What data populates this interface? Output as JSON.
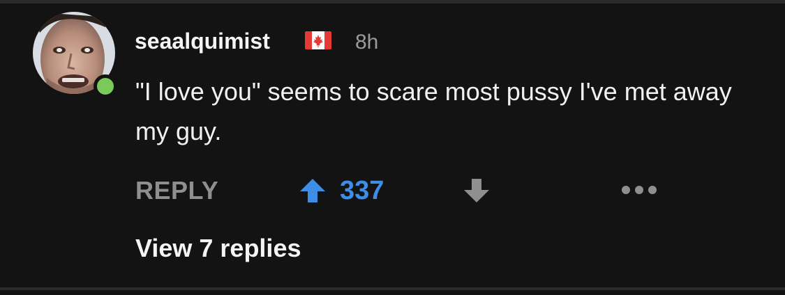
{
  "comment": {
    "username": "seaalquimist",
    "flag_icon": "canada-flag-icon",
    "timestamp": "8h",
    "text": "\"I love you\" seems to scare most pussy I've met away my guy.",
    "online": true
  },
  "actions": {
    "reply_label": "REPLY",
    "upvote_icon": "arrow-up-icon",
    "vote_count": "337",
    "downvote_icon": "arrow-down-icon",
    "more_icon": "ellipsis-icon"
  },
  "replies": {
    "view_label": "View 7 replies"
  },
  "colors": {
    "background": "#131313",
    "upvoted_accent": "#3e8de6",
    "muted_text": "#8f8f8f",
    "online_dot": "#7bc95a"
  }
}
